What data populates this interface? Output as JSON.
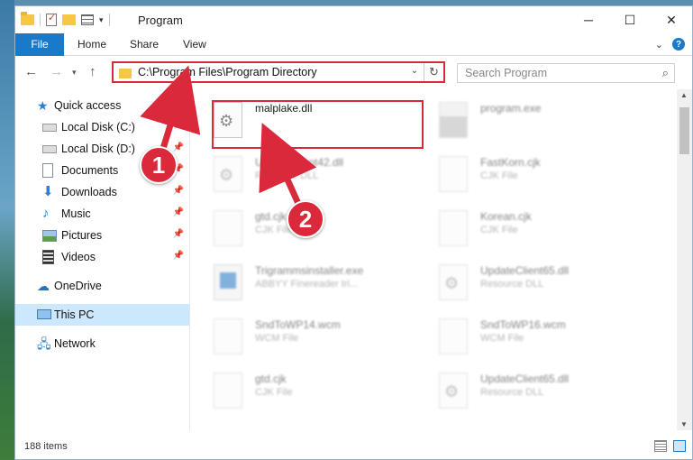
{
  "window": {
    "title": "Program",
    "controls": {
      "minimize": "─",
      "maximize": "☐",
      "close": "✕"
    }
  },
  "ribbon": {
    "tabs": [
      "File",
      "Home",
      "Share",
      "View"
    ],
    "expand": "⌄",
    "help": "?"
  },
  "address_bar": {
    "path": "C:\\Program Files\\Program Directory",
    "chevron": "⌄",
    "refresh": "↻"
  },
  "search": {
    "placeholder": "Search Program",
    "icon": "⌕"
  },
  "nav_pane": {
    "quick_access": "Quick access",
    "items": [
      {
        "label": "Local Disk (C:)",
        "icon": "drive-icon",
        "pinned": true
      },
      {
        "label": "Local Disk (D:)",
        "icon": "drive-icon",
        "pinned": true
      },
      {
        "label": "Documents",
        "icon": "documents-icon",
        "pinned": true
      },
      {
        "label": "Downloads",
        "icon": "downloads-icon",
        "pinned": true
      },
      {
        "label": "Music",
        "icon": "music-icon",
        "pinned": true
      },
      {
        "label": "Pictures",
        "icon": "pictures-icon",
        "pinned": true
      },
      {
        "label": "Videos",
        "icon": "videos-icon",
        "pinned": true
      }
    ],
    "onedrive": "OneDrive",
    "this_pc": "This PC",
    "network": "Network"
  },
  "files": [
    {
      "name": "malplake.dll",
      "type": "",
      "icon": "dll-gear-icon",
      "highlighted": true
    },
    {
      "name": "program.exe",
      "type": "",
      "icon": "exe-icon"
    },
    {
      "name": "UpdateClient42.dll",
      "type": "Resource DLL",
      "icon": "dll-gear-icon"
    },
    {
      "name": "FastKorn.cjk",
      "type": "CJK File",
      "icon": "blank-file-icon"
    },
    {
      "name": "gtd.cjk",
      "type": "CJK File",
      "icon": "blank-file-icon"
    },
    {
      "name": "Korean.cjk",
      "type": "CJK File",
      "icon": "blank-file-icon"
    },
    {
      "name": "Trigrammsinstaller.exe",
      "type": "ABBYY Finereader tri...",
      "icon": "app-icon"
    },
    {
      "name": "UpdateClient65.dll",
      "type": "Resource DLL",
      "icon": "dll-gear-icon"
    },
    {
      "name": "SndToWP14.wcm",
      "type": "WCM File",
      "icon": "blank-file-icon"
    },
    {
      "name": "SndToWP16.wcm",
      "type": "WCM File",
      "icon": "blank-file-icon"
    },
    {
      "name": "gtd.cjk",
      "type": "CJK File",
      "icon": "blank-file-icon"
    },
    {
      "name": "UpdateClient65.dll",
      "type": "Resource DLL",
      "icon": "dll-gear-icon"
    }
  ],
  "status": {
    "items": "188 items"
  },
  "annotations": {
    "step1": "1",
    "step2": "2",
    "accent": "#d9293a"
  }
}
